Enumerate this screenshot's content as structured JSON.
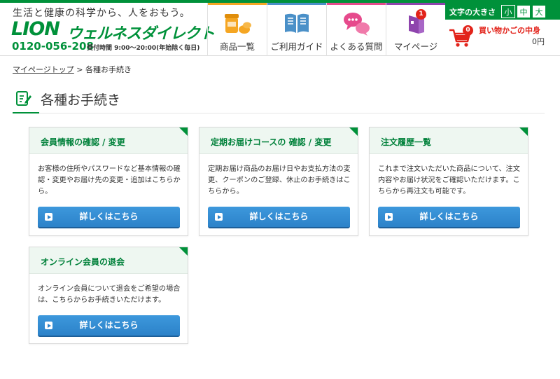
{
  "header": {
    "tagline": "生活と健康の科学から、人をおもう。",
    "logo_brand": "LION",
    "logo_name": "ウェルネスダイレクト",
    "phone": "0120-056-208",
    "hours": "受付時間 9:00～20:00(年始除く毎日)",
    "nav": [
      {
        "label": "商品一覧",
        "icon": "products-icon",
        "color": "#f5a623"
      },
      {
        "label": "ご利用ガイド",
        "icon": "guide-book-icon",
        "color": "#4a90c8"
      },
      {
        "label": "よくある質問",
        "icon": "faq-chat-icon",
        "color": "#e64a8c"
      },
      {
        "label": "マイページ",
        "icon": "mypage-icon",
        "color": "#8e44ad",
        "badge": "1"
      }
    ],
    "font_size": {
      "label": "文字の大きさ",
      "options": [
        "小",
        "中",
        "大"
      ],
      "selected": "小"
    },
    "cart": {
      "title": "買い物かごの中身",
      "count": "0",
      "amount": "0円"
    }
  },
  "breadcrumb": {
    "home": "マイページトップ",
    "separator": ">",
    "current": "各種お手続き"
  },
  "page_title": "各種お手続き",
  "cards": [
    {
      "title": "会員情報の確認 / 変更",
      "description": "お客様の住所やパスワードなど基本情報の確認・変更やお届け先の変更・追加はこちらから。",
      "button": "詳しくはこちら"
    },
    {
      "title": "定期お届けコースの 確認 / 変更",
      "description": "定期お届け商品のお届け日やお支払方法の変更、クーポンのご登録、休止のお手続きはこちらから。",
      "button": "詳しくはこちら"
    },
    {
      "title": "注文履歴一覧",
      "description": "これまで注文いただいた商品について、注文内容やお届け状況をご確認いただけます。こちらから再注文も可能です。",
      "button": "詳しくはこちら"
    },
    {
      "title": "オンライン会員の退会",
      "description": "オンライン会員について退会をご希望の場合は、こちらからお手続きいただけます。",
      "button": "詳しくはこちら"
    }
  ],
  "colors": {
    "brand_green": "#00913a",
    "button_blue": "#2c82c9",
    "alert_red": "#e2231a"
  }
}
